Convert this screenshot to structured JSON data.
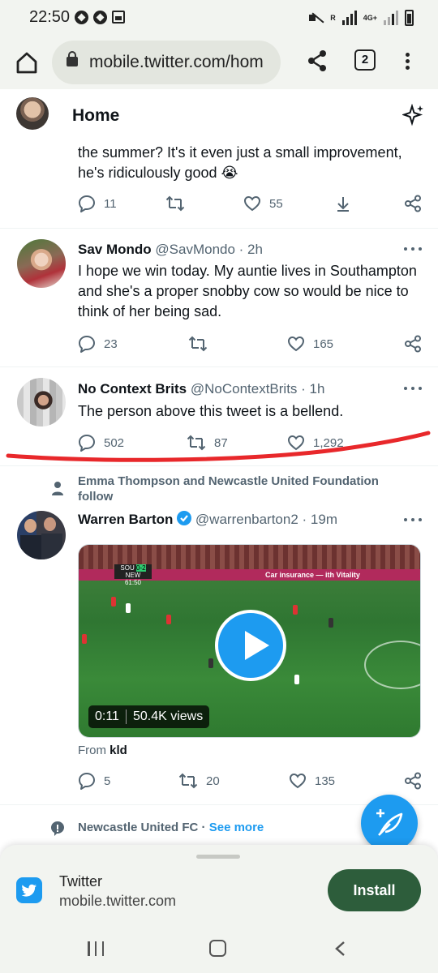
{
  "status_bar": {
    "time": "22:50",
    "network": "4G+",
    "carrier_mark": "R"
  },
  "browser": {
    "url": "mobile.twitter.com/hom",
    "tab_count": "2"
  },
  "header": {
    "title": "Home"
  },
  "tweets": [
    {
      "text": "the summer? It's it even just a small improvement, he's ridiculously good 😭",
      "replies": "11",
      "retweets": "",
      "likes": "55"
    },
    {
      "name": "Sav Mondo",
      "handle": "@SavMondo",
      "time": "· 2h",
      "text": "I hope we win today. My auntie lives in Southampton and she's a proper snobby cow so would be nice to think of her being sad.",
      "replies": "23",
      "retweets": "",
      "likes": "165"
    },
    {
      "name": "No Context Brits",
      "handle": "@NoContextBrits",
      "time": "· 1h",
      "text": "The person above this tweet is a bellend.",
      "replies": "502",
      "retweets": "87",
      "likes": "1,292"
    },
    {
      "social_context": "Emma Thompson and Newcastle United Foundation follow",
      "name": "Warren Barton",
      "handle": "@warrenbarton2",
      "time": "· 19m",
      "video": {
        "duration": "0:11",
        "views": "50.4K views",
        "score_home": "SOU",
        "score": "0-2",
        "score_away": "NEW",
        "clock": "61:50",
        "board_text": "Car insurance — ith Vitality"
      },
      "from_prefix": "From",
      "from_source": "kld",
      "replies": "5",
      "retweets": "20",
      "likes": "135"
    }
  ],
  "next_context": {
    "name": "Newcastle United FC",
    "separator": "·",
    "see_more": "See more"
  },
  "install_sheet": {
    "app_name": "Twitter",
    "app_url": "mobile.twitter.com",
    "button": "Install"
  },
  "colors": {
    "twitter_blue": "#1d9bf0",
    "install_green": "#2d5d3b",
    "annotation_red": "#e8282b",
    "muted_text": "#536471"
  }
}
